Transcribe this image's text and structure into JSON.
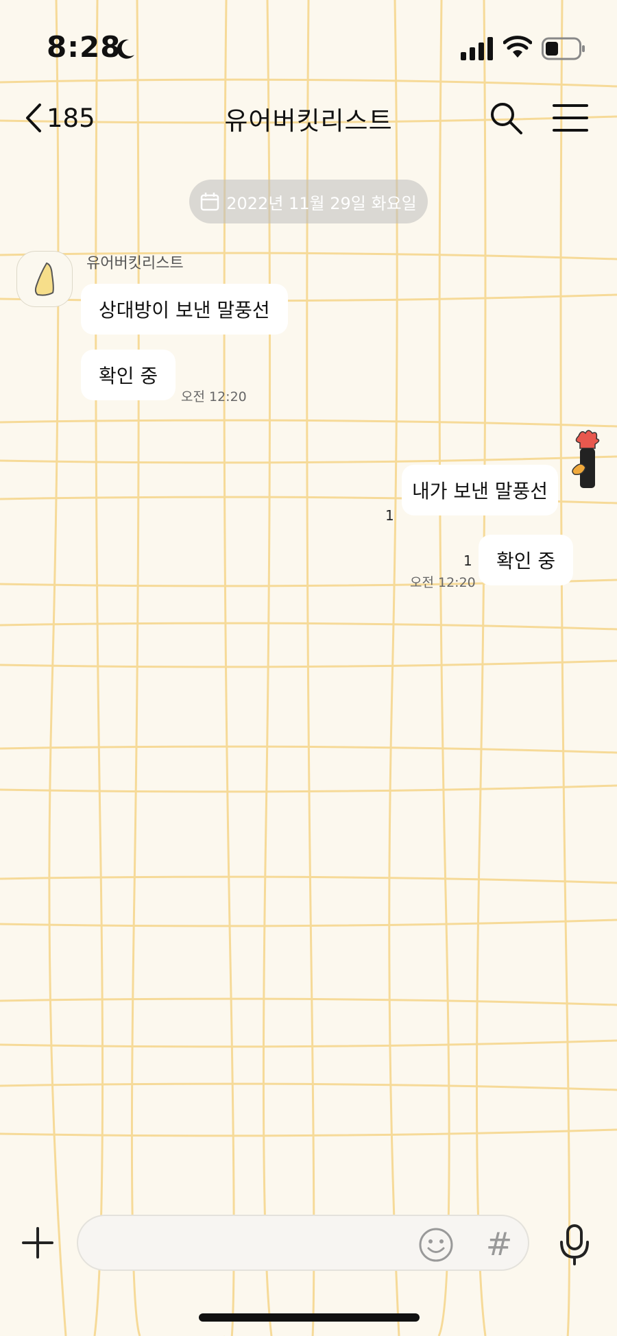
{
  "status_bar": {
    "time": "8:28"
  },
  "header": {
    "back_count": "185",
    "title": "유어버킷리스트",
    "icons": {
      "back": "chevron-left-icon",
      "search": "search-icon",
      "menu": "hamburger-menu-icon"
    }
  },
  "date_divider": {
    "text": "2022년 11월 29일 화요일",
    "icon": "calendar-icon"
  },
  "messages": [
    {
      "side": "received",
      "sender": "유어버킷리스트",
      "text": "상대방이 보낸 말풍선"
    },
    {
      "side": "received",
      "text": "확인 중",
      "time": "오전 12:20"
    },
    {
      "side": "sent",
      "text": "내가 보낸 말풍선",
      "unread": "1"
    },
    {
      "side": "sent",
      "text": "확인 중",
      "unread": "1",
      "time": "오전 12:20"
    }
  ],
  "input_bar": {
    "placeholder": "",
    "hash_label": "#",
    "icons": {
      "plus": "plus-icon",
      "emoji": "emoji-icon",
      "mic": "microphone-icon"
    }
  },
  "colors": {
    "background": "#fcf8ee",
    "grid_lines": "#f5d58a",
    "bubble": "#ffffff",
    "date_pill": "#c8c8c8"
  }
}
